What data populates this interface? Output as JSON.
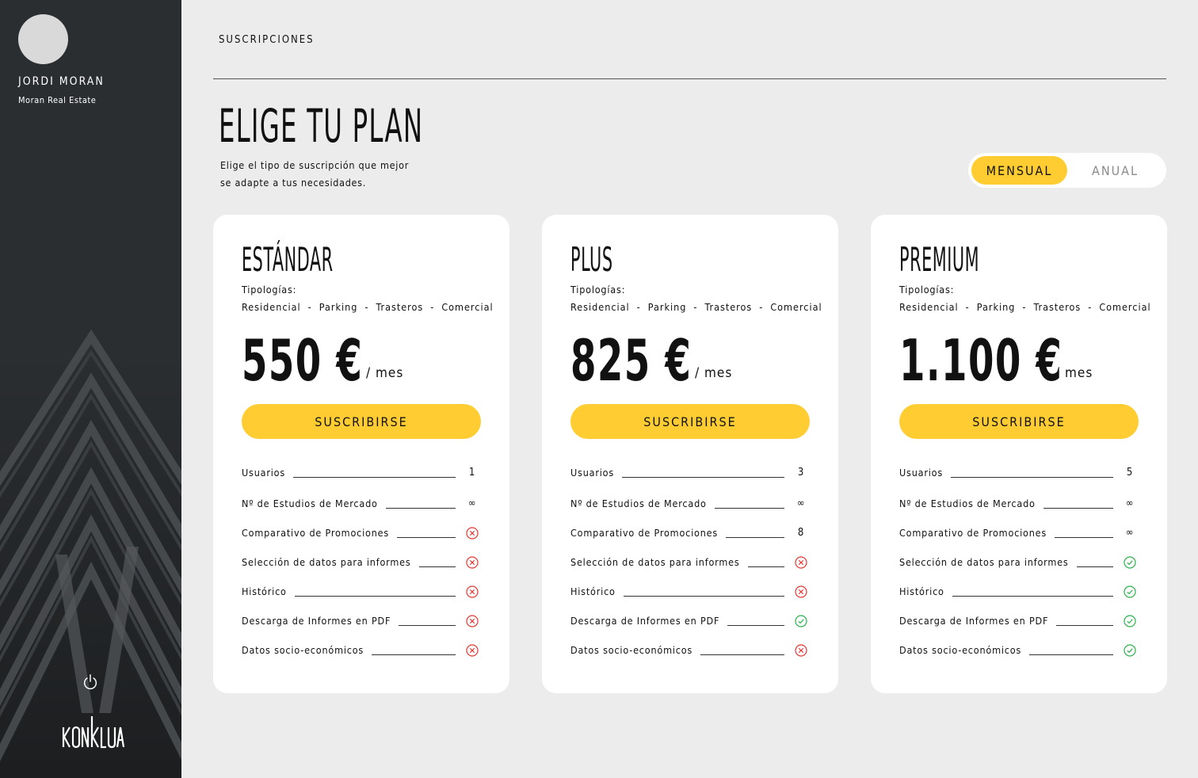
{
  "user": {
    "name": "JORDI MORAN",
    "company": "Moran Real Estate"
  },
  "sidebar": {
    "logo_text": "KONKLUA",
    "logout_icon": "power-icon"
  },
  "header": {
    "section": "SUSCRIPCIONES"
  },
  "main": {
    "title": "ELIGE TU PLAN",
    "subtitle": "Elige el tipo de suscripción que mejor se adapte a tus necesidades.",
    "billing_toggle": {
      "options": [
        "MENSUAL",
        "ANUAL"
      ],
      "selected": "MENSUAL"
    }
  },
  "colors": {
    "accent": "#ffcd32",
    "sidebar_bg": "#2b2e31",
    "page_bg": "#ececec",
    "no": "#e53935",
    "yes": "#2bb24c"
  },
  "plans": [
    {
      "name": "ESTÁNDAR",
      "typologies_label": "Tipologías:",
      "typologies": [
        "Residencial",
        "Parking",
        "Trasteros",
        "Comercial"
      ],
      "price": "550 €",
      "period": "/ mes",
      "cta": "SUSCRIBIRSE",
      "features": [
        {
          "label": "Usuarios",
          "value": "1"
        },
        {
          "label": "Nº de Estudios de Mercado",
          "value": "∞"
        },
        {
          "label": "Comparativo de Promociones",
          "value": "no"
        },
        {
          "label": "Selección de datos para informes",
          "value": "no"
        },
        {
          "label": "Histórico",
          "value": "no"
        },
        {
          "label": "Descarga de Informes en PDF",
          "value": "no"
        },
        {
          "label": "Datos socio-económicos",
          "value": "no"
        }
      ]
    },
    {
      "name": "PLUS",
      "typologies_label": "Tipologías:",
      "typologies": [
        "Residencial",
        "Parking",
        "Trasteros",
        "Comercial"
      ],
      "price": "825 €",
      "period": "/ mes",
      "cta": "SUSCRIBIRSE",
      "features": [
        {
          "label": "Usuarios",
          "value": "3"
        },
        {
          "label": "Nº de Estudios de Mercado",
          "value": "∞"
        },
        {
          "label": "Comparativo de Promociones",
          "value": "8"
        },
        {
          "label": "Selección de datos para informes",
          "value": "no"
        },
        {
          "label": "Histórico",
          "value": "no"
        },
        {
          "label": "Descarga de Informes en PDF",
          "value": "yes"
        },
        {
          "label": "Datos socio-económicos",
          "value": "no"
        }
      ]
    },
    {
      "name": "PREMIUM",
      "typologies_label": "Tipologías:",
      "typologies": [
        "Residencial",
        "Parking",
        "Trasteros",
        "Comercial"
      ],
      "price": "1.100 €",
      "period": "/ mes",
      "cta": "SUSCRIBIRSE",
      "features": [
        {
          "label": "Usuarios",
          "value": "5"
        },
        {
          "label": "Nº de Estudios de Mercado",
          "value": "∞"
        },
        {
          "label": "Comparativo de Promociones",
          "value": "∞"
        },
        {
          "label": "Selección de datos para informes",
          "value": "yes"
        },
        {
          "label": "Histórico",
          "value": "yes"
        },
        {
          "label": "Descarga de Informes en PDF",
          "value": "yes"
        },
        {
          "label": "Datos socio-económicos",
          "value": "yes"
        }
      ]
    }
  ]
}
